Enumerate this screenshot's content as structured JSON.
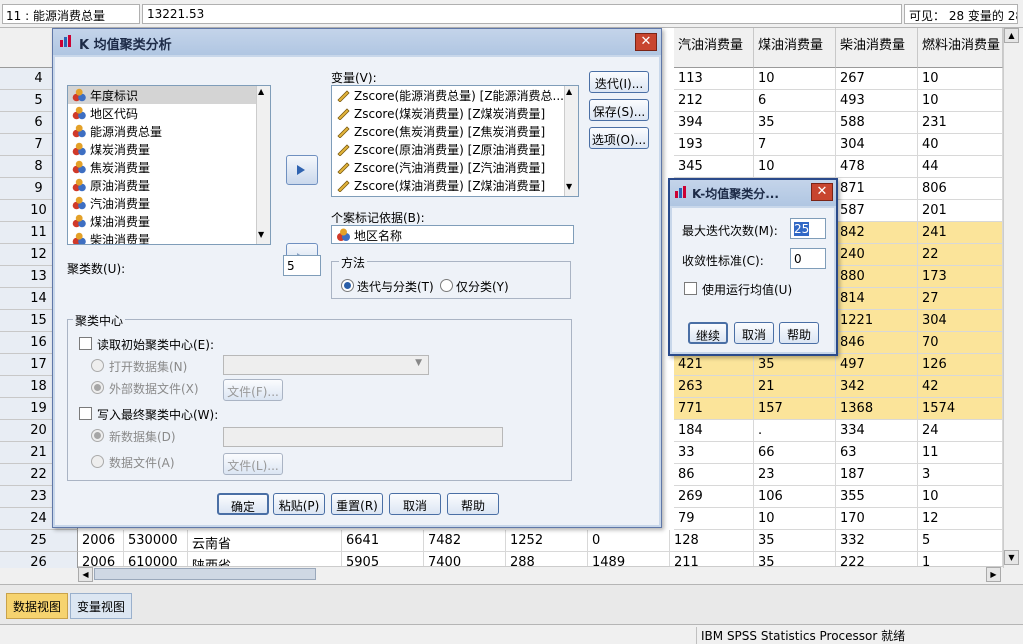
{
  "cellbar": {
    "ref": "11 : 能源消费总量",
    "value": "13221.53",
    "visible": "可见： 28 变量的 28"
  },
  "columns": [
    "汽油消费量",
    "煤油消费量",
    "柴油消费量",
    "燃料油消费量"
  ],
  "rows": [
    {
      "n": "4",
      "v": [
        "113",
        "10",
        "267",
        "10"
      ],
      "hl": false
    },
    {
      "n": "5",
      "v": [
        "212",
        "6",
        "493",
        "10"
      ],
      "hl": false
    },
    {
      "n": "6",
      "v": [
        "394",
        "35",
        "588",
        "231"
      ],
      "hl": false
    },
    {
      "n": "7",
      "v": [
        "193",
        "7",
        "304",
        "40"
      ],
      "hl": false
    },
    {
      "n": "8",
      "v": [
        "345",
        "10",
        "478",
        "44"
      ],
      "hl": false
    },
    {
      "n": "9",
      "v": [
        "",
        "",
        "871",
        "806"
      ],
      "hl": false
    },
    {
      "n": "10",
      "v": [
        "",
        "",
        "587",
        "201"
      ],
      "hl": false
    },
    {
      "n": "11",
      "v": [
        "",
        "",
        "842",
        "241"
      ],
      "hl": true
    },
    {
      "n": "12",
      "v": [
        "",
        "",
        "240",
        "22"
      ],
      "hl": true
    },
    {
      "n": "13",
      "v": [
        "",
        "",
        "880",
        "173"
      ],
      "hl": true
    },
    {
      "n": "14",
      "v": [
        "",
        "",
        "814",
        "27"
      ],
      "hl": true
    },
    {
      "n": "15",
      "v": [
        "",
        "",
        "1221",
        "304"
      ],
      "hl": true
    },
    {
      "n": "16",
      "v": [
        "",
        "",
        "846",
        "70"
      ],
      "hl": true
    },
    {
      "n": "17",
      "v": [
        "421",
        "35",
        "497",
        "126"
      ],
      "hl": true
    },
    {
      "n": "18",
      "v": [
        "263",
        "21",
        "342",
        "42"
      ],
      "hl": true
    },
    {
      "n": "19",
      "v": [
        "771",
        "157",
        "1368",
        "1574"
      ],
      "hl": true
    },
    {
      "n": "20",
      "v": [
        "184",
        ".",
        "334",
        "24"
      ],
      "hl": false
    },
    {
      "n": "21",
      "v": [
        "33",
        "66",
        "63",
        "11"
      ],
      "hl": false
    },
    {
      "n": "22",
      "v": [
        "86",
        "23",
        "187",
        "3"
      ],
      "hl": false
    },
    {
      "n": "23",
      "v": [
        "269",
        "106",
        "355",
        "10"
      ],
      "hl": false
    },
    {
      "n": "24",
      "v": [
        "79",
        "10",
        "170",
        "12"
      ],
      "hl": false
    }
  ],
  "row25": {
    "n": "25",
    "cells": [
      "2006",
      "530000",
      "云南省",
      "6641",
      "7482",
      "1252",
      "0",
      "128",
      "35",
      "332",
      "5"
    ]
  },
  "row26": {
    "n": "26",
    "cells": [
      "2006",
      "610000",
      "陕西省",
      "5905",
      "7400",
      "288",
      "1489",
      "211",
      "35",
      "222",
      "1"
    ]
  },
  "tabs": [
    "数据视图",
    "变量视图"
  ],
  "status": "IBM SPSS Statistics Processor 就绪",
  "kmeans": {
    "title": "K 均值聚类分析",
    "source_items": [
      "年度标识",
      "地区代码",
      "能源消费总量",
      "煤炭消费量",
      "焦炭消费量",
      "原油消费量",
      "汽油消费量",
      "煤油消费量",
      "柴油消费量"
    ],
    "var_label": "变量(V):",
    "var_items": [
      "Zscore(能源消费总量) [Z能源消费总...",
      "Zscore(煤炭消费量) [Z煤炭消费量]",
      "Zscore(焦炭消费量) [Z焦炭消费量]",
      "Zscore(原油消费量) [Z原油消费量]",
      "Zscore(汽油消费量) [Z汽油消费量]",
      "Zscore(煤油消费量) [Z煤油消费量]"
    ],
    "case_label": "个案标记依据(B):",
    "case_value": "地区名称",
    "clusters_label": "聚类数(U):",
    "clusters_value": "5",
    "method_label": "方法",
    "method_iter": "迭代与分类(T)",
    "method_classify": "仅分类(Y)",
    "side_buttons": [
      "迭代(I)...",
      "保存(S)...",
      "选项(O)..."
    ],
    "centers_label": "聚类中心",
    "read_initial": "读取初始聚类中心(E):",
    "open_dataset": "打开数据集(N)",
    "external_file": "外部数据文件(X)",
    "file_btn1": "文件(F)...",
    "write_final": "写入最终聚类中心(W):",
    "new_dataset": "新数据集(D)",
    "data_file": "数据文件(A)",
    "file_btn2": "文件(L)...",
    "bottom_buttons": [
      "确定",
      "粘贴(P)",
      "重置(R)",
      "取消",
      "帮助"
    ]
  },
  "iter": {
    "title": "K-均值聚类分...",
    "max_label": "最大迭代次数(M):",
    "max_value": "25",
    "conv_label": "收敛性标准(C):",
    "conv_value": "0",
    "running_label": "使用运行均值(U)",
    "buttons": [
      "继续",
      "取消",
      "帮助"
    ]
  }
}
